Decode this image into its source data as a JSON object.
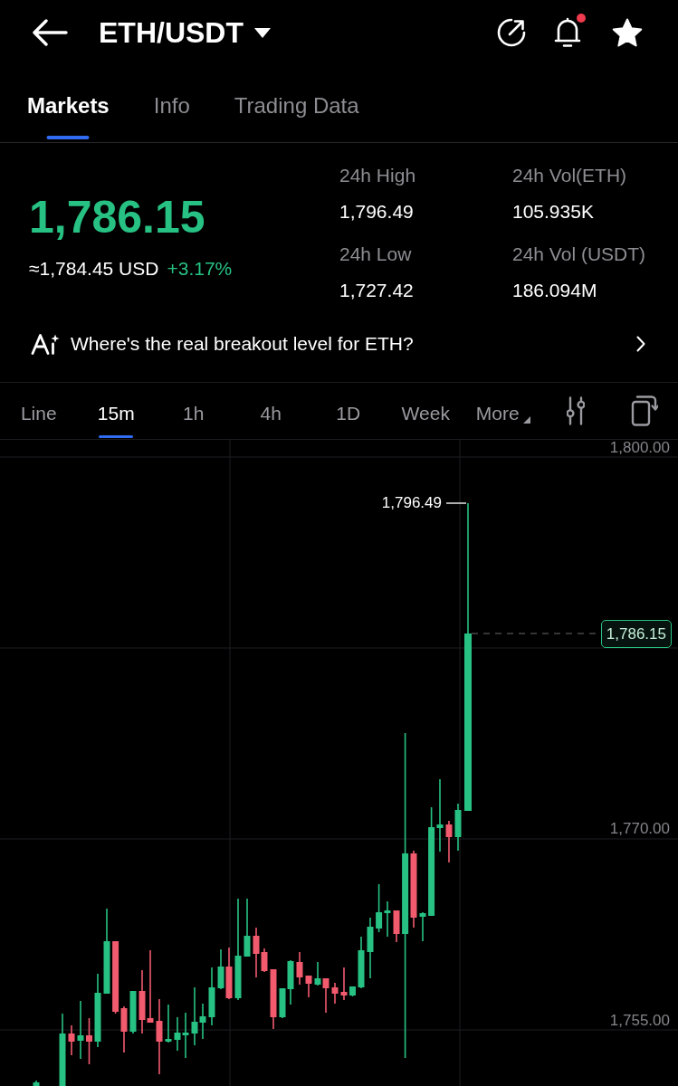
{
  "header": {
    "title": "ETH/USDT",
    "has_alert": true,
    "favorite": true
  },
  "tabs": [
    {
      "label": "Markets",
      "selected": true
    },
    {
      "label": "Info",
      "selected": false
    },
    {
      "label": "Trading Data",
      "selected": false
    }
  ],
  "ticker": {
    "rising": true,
    "last_price": "1,786.15",
    "usd_price": "≈1,784.45 USD",
    "change": "+3.17%",
    "stats": [
      {
        "label": "24h High",
        "value": "1,796.49"
      },
      {
        "label": "24h Vol(ETH)",
        "value": "105.935K"
      },
      {
        "label": "24h Low",
        "value": "1,727.42"
      },
      {
        "label": "24h Vol (USDT)",
        "value": "186.094M"
      }
    ]
  },
  "insight": {
    "text": "Where's the real breakout level for ETH?"
  },
  "intervals": [
    {
      "label": "Line",
      "kind": "option",
      "selected": false
    },
    {
      "label": "15m",
      "kind": "option",
      "selected": true
    },
    {
      "label": "1h",
      "kind": "option",
      "selected": false
    },
    {
      "label": "4h",
      "kind": "option",
      "selected": false
    },
    {
      "label": "1D",
      "kind": "option",
      "selected": false
    },
    {
      "label": "Week",
      "kind": "option",
      "selected": false
    },
    {
      "label": "More",
      "kind": "menu",
      "selected": false
    }
  ],
  "chart": {
    "y_axis": [
      {
        "label": "1,800.00"
      },
      {
        "label": "1,770.00"
      },
      {
        "label": "1,755.00"
      }
    ],
    "high_label": "1,796.49",
    "price_tag": "1,786.15"
  }
}
